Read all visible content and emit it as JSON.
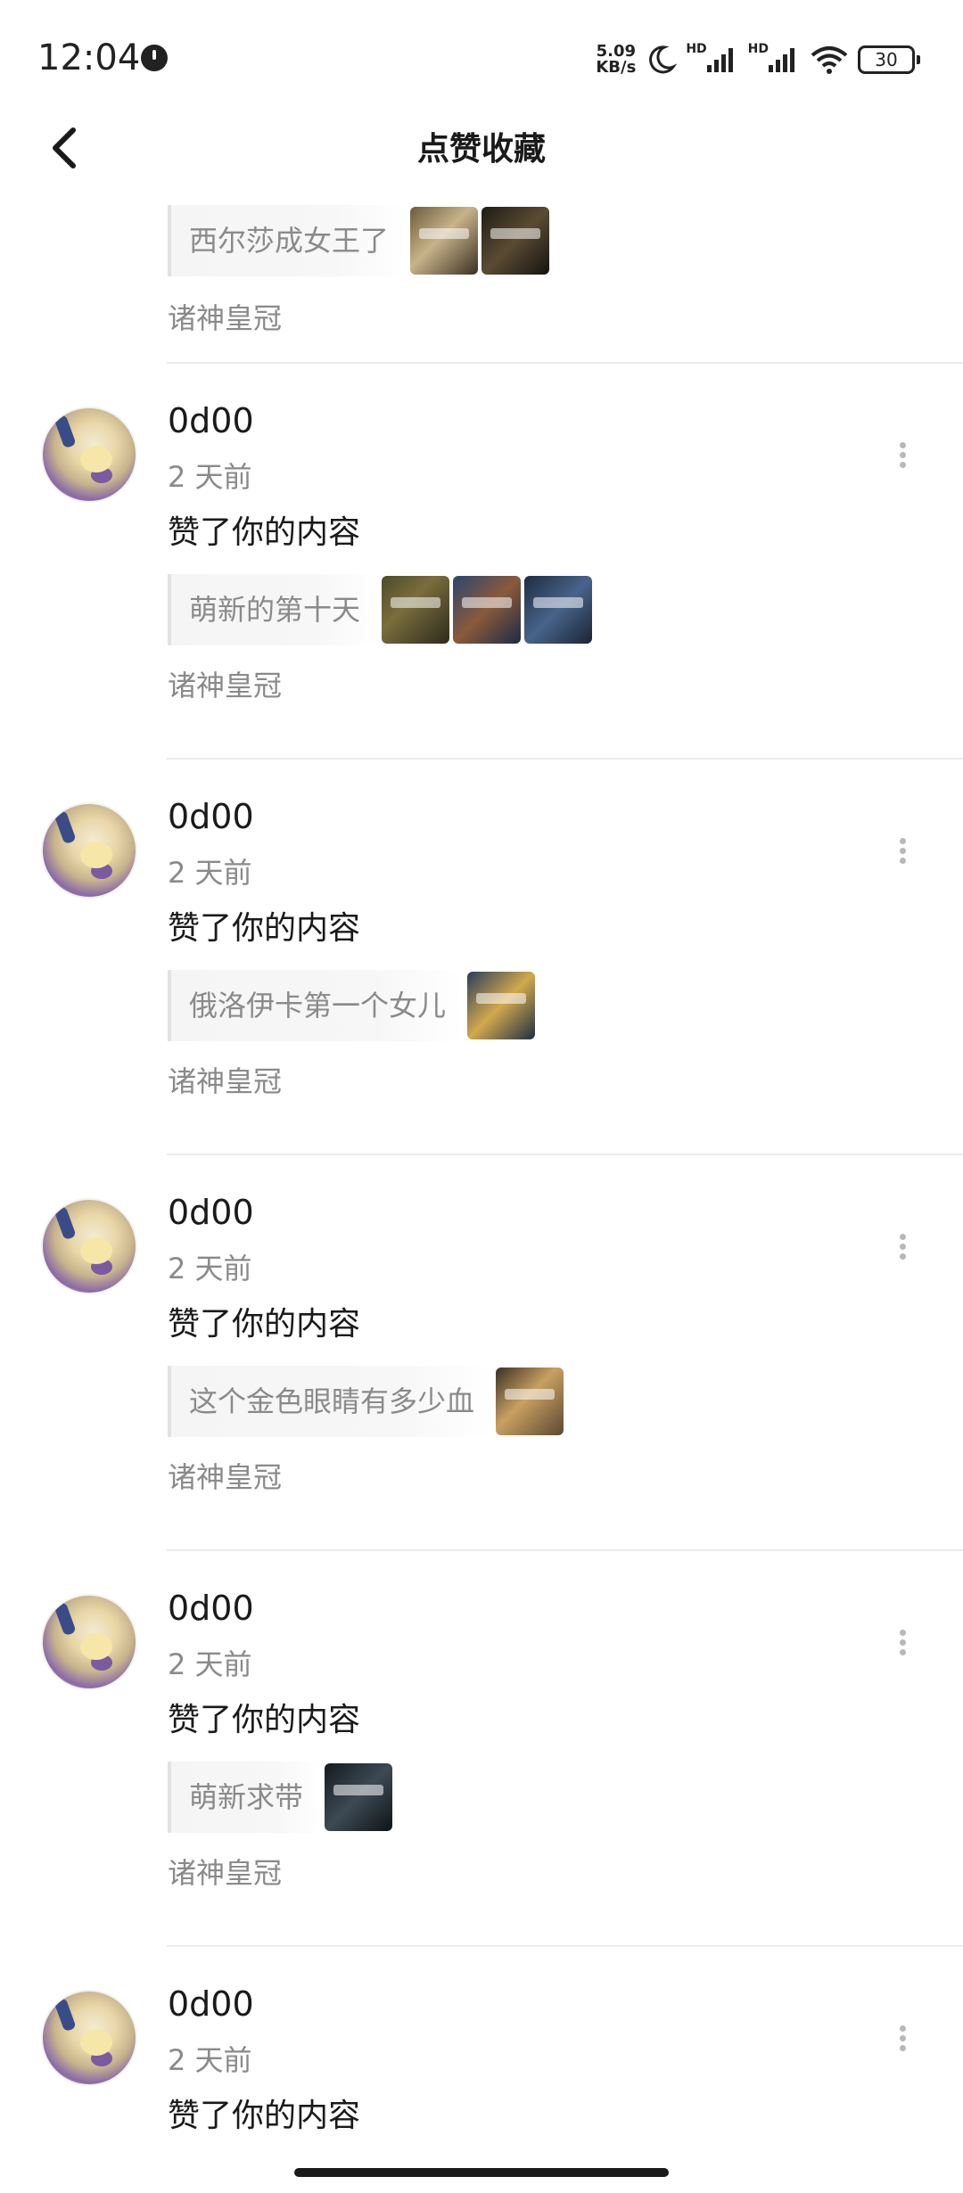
{
  "status_bar": {
    "time": "12:04",
    "net_speed_value": "5.09",
    "net_speed_unit": "KB/s",
    "hd_label_1": "HD",
    "hd_label_2": "HD",
    "battery": "30",
    "icons": [
      "clock-icon",
      "moon-icon",
      "signal-icon",
      "wifi-icon",
      "battery-icon"
    ]
  },
  "header": {
    "title": "点赞收藏",
    "back_icon": "chevron-left-icon"
  },
  "first_partial": {
    "quote": "西尔莎成女王了",
    "game": "诸神皇冠"
  },
  "items": [
    {
      "username": "0d00",
      "time": "2 天前",
      "action": "赞了你的内容",
      "quote": "萌新的第十天",
      "game": "诸神皇冠"
    },
    {
      "username": "0d00",
      "time": "2 天前",
      "action": "赞了你的内容",
      "quote": "俄洛伊卡第一个女儿",
      "game": "诸神皇冠"
    },
    {
      "username": "0d00",
      "time": "2 天前",
      "action": "赞了你的内容",
      "quote": "这个金色眼睛有多少血",
      "game": "诸神皇冠"
    },
    {
      "username": "0d00",
      "time": "2 天前",
      "action": "赞了你的内容",
      "quote": "萌新求带",
      "game": "诸神皇冠"
    },
    {
      "username": "0d00",
      "time": "2 天前",
      "action": "赞了你的内容"
    }
  ]
}
